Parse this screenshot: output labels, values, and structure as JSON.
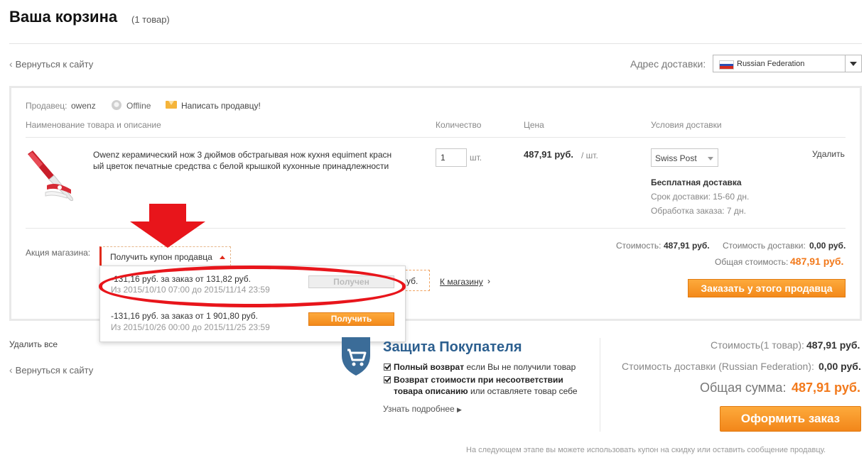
{
  "header": {
    "title": "Ваша корзина",
    "count": "(1 товар)",
    "back_link": "Вернуться к сайту",
    "address_label": "Адрес доставки:",
    "country": "Russian Federation"
  },
  "seller": {
    "label": "Продавец:",
    "name": "owenz",
    "status": "Offline",
    "contact": "Написать продавцу!"
  },
  "columns": {
    "name": "Наименование товара и описание",
    "quantity": "Количество",
    "price": "Цена",
    "shipping": "Условия доставки"
  },
  "item": {
    "name": "Owenz керамический нож 3 дюймов обстрагывая нож кухня equiment красный цветок печатные средства с белой крышкой кухонные принадлежности",
    "quantity": "1",
    "quantity_unit": "шт.",
    "price": "487,91 руб.",
    "price_unit": "/ шт.",
    "shipping_method": "Swiss Post",
    "delete": "Удалить",
    "free_shipping": "Бесплатная доставка",
    "delivery_time": "Срок доставки: 15-60 дн.",
    "processing_time": "Обработка заказа: 7 дн."
  },
  "promo": {
    "label": "Акция магазина:",
    "coupon_trigger": "Получить купон продавца",
    "partial_text": "уб.",
    "shop_link": "К магазину",
    "coupons": [
      {
        "title": "-131,16 руб. за заказ от 131,82 руб.",
        "dates": "Из 2015/10/10 07:00 до 2015/11/14 23:59",
        "button": "Получен"
      },
      {
        "title": "-131,16 руб. за заказ от 1 901,80 руб.",
        "dates": "Из 2015/10/26 00:00 до 2015/11/25 23:59",
        "button": "Получить"
      }
    ]
  },
  "seller_summary": {
    "cost_label": "Стоимость:",
    "cost_value": "487,91 руб.",
    "shipping_label": "Стоимость доставки:",
    "shipping_value": "0,00 руб.",
    "total_label": "Общая стоимость:",
    "total_value": "487,91 руб.",
    "order_button": "Заказать у этого продавца"
  },
  "bottom": {
    "delete_all": "Удалить все",
    "back_link": "Вернуться к сайту",
    "protection_title": "Защита Покупателя",
    "protection_1_bold": "Полный возврат",
    "protection_1_rest": " если Вы не получили товар",
    "protection_2_bold_a": "Возврат стоимости при несоответствии",
    "protection_2_bold_b": "товара описанию",
    "protection_2_rest": " или оставляете товар себе",
    "learn_more": "Узнать подробнее",
    "cost_label": "Стоимость(1 товар):",
    "cost_value": "487,91 руб.",
    "shipping_label": "Стоимость доставки (Russian Federation):",
    "shipping_value": "0,00 руб.",
    "grand_label": "Общая сумма:",
    "grand_value": "487,91 руб.",
    "checkout_button": "Оформить заказ",
    "footnote": "На следующем этапе вы можете использовать купон на скидку или оставить сообщение продавцу."
  },
  "colors": {
    "accent_orange": "#f2791b",
    "highlight_red": "#e8151b",
    "protection_blue": "#2c5f8f"
  }
}
